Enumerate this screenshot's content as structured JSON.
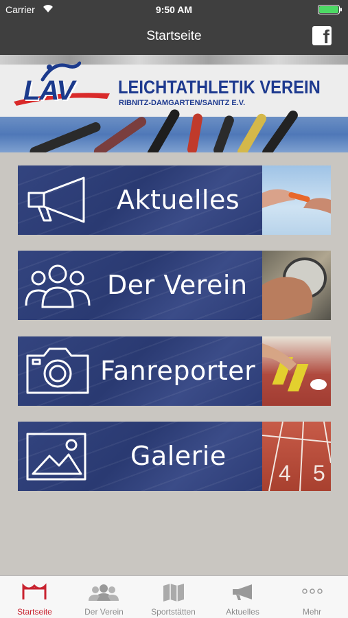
{
  "status_bar": {
    "carrier": "Carrier",
    "time": "9:50 AM"
  },
  "nav": {
    "title": "Startseite",
    "facebook_icon": "facebook-icon"
  },
  "banner": {
    "logo_text": "LAV",
    "club_name": "LEICHTATHLETIK VEREIN",
    "club_sub": "RIBNITZ-DAMGARTEN/SANITZ E.V."
  },
  "tiles": [
    {
      "label": "Aktuelles",
      "icon": "megaphone-icon"
    },
    {
      "label": "Der Verein",
      "icon": "group-icon"
    },
    {
      "label": "Fanreporter",
      "icon": "camera-icon"
    },
    {
      "label": "Galerie",
      "icon": "image-icon"
    }
  ],
  "tabs": [
    {
      "label": "Startseite",
      "icon": "home-gate-icon",
      "active": true
    },
    {
      "label": "Der Verein",
      "icon": "people-icon",
      "active": false
    },
    {
      "label": "Sportstätten",
      "icon": "map-icon",
      "active": false
    },
    {
      "label": "Aktuelles",
      "icon": "megaphone-icon",
      "active": false
    },
    {
      "label": "Mehr",
      "icon": "more-icon",
      "active": false
    }
  ],
  "colors": {
    "bar": "#3f3f3f",
    "tile_blue": "#2d3e7b",
    "accent_red": "#c8222f",
    "background": "#c9c6c1"
  }
}
